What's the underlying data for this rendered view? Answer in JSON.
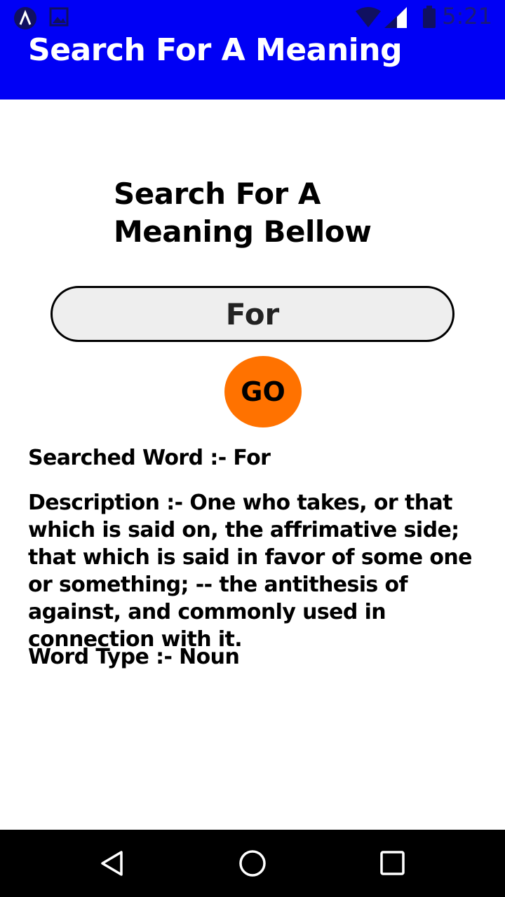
{
  "status_bar": {
    "time": "5:21",
    "icons": [
      "app-notification-icon",
      "image-notification-icon",
      "wifi-icon",
      "signal-icon",
      "battery-icon"
    ]
  },
  "app_bar": {
    "title": "Search For A Meaning",
    "color": "#0000f5"
  },
  "main": {
    "heading": "Search For A Meaning Bellow",
    "search_value": "For",
    "go_label": "GO",
    "go_color": "#ff7200",
    "searched_word": "Searched Word :- For",
    "description": "Description :- One who takes, or that which is said on, the affrimative side; that which is said in favor of some one or something; -- the antithesis of against, and commonly used in connection with it.",
    "word_type": "Word Type :- Noun"
  },
  "nav_bar": {
    "icons": [
      "back-icon",
      "home-icon",
      "recents-icon"
    ]
  }
}
